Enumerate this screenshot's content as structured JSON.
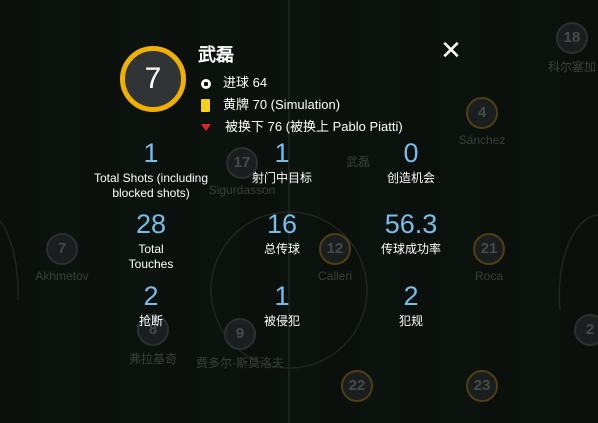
{
  "player": {
    "number": "7",
    "name": "武磊",
    "events": [
      {
        "icon": "ball-icon",
        "text": "进球 64"
      },
      {
        "icon": "yellow-card-icon",
        "text": "黄牌 70 (Simulation)"
      },
      {
        "icon": "sub-out-icon",
        "text": "被换下 76 (被换上 Pablo Piatti)"
      }
    ]
  },
  "close_label": "✕",
  "stats": [
    {
      "value": "1",
      "label": "Total Shots (including blocked shots)"
    },
    {
      "value": "1",
      "label": "射门中目标"
    },
    {
      "value": "0",
      "label": "创造机会"
    },
    {
      "value": "28",
      "label": "Total Touches"
    },
    {
      "value": "16",
      "label": "总传球"
    },
    {
      "value": "56.3",
      "label": "传球成功率"
    },
    {
      "value": "2",
      "label": "抢断"
    },
    {
      "value": "1",
      "label": "被侵犯"
    },
    {
      "value": "2",
      "label": "犯规"
    }
  ],
  "background_players": [
    {
      "number": "18",
      "name": "科尔塞加"
    },
    {
      "number": "4",
      "name": "Sánchez"
    },
    {
      "number": "17",
      "name": "Sigurdasson"
    },
    {
      "number": "",
      "name": "武磊"
    },
    {
      "number": "7",
      "name": "Akhmetov"
    },
    {
      "number": "12",
      "name": "Calleri"
    },
    {
      "number": "21",
      "name": "Roca"
    },
    {
      "number": "8",
      "name": "弗拉基奇"
    },
    {
      "number": "9",
      "name": "费多尔·斯莫洛夫"
    },
    {
      "number": "22",
      "name": ""
    },
    {
      "number": "23",
      "name": ""
    },
    {
      "number": "2",
      "name": ""
    }
  ],
  "colors": {
    "accent": "#f0b000",
    "stat_value": "#77bdea",
    "yellow_card": "#f4d21a",
    "sub_out": "#e02525",
    "background": "#0f1612"
  }
}
